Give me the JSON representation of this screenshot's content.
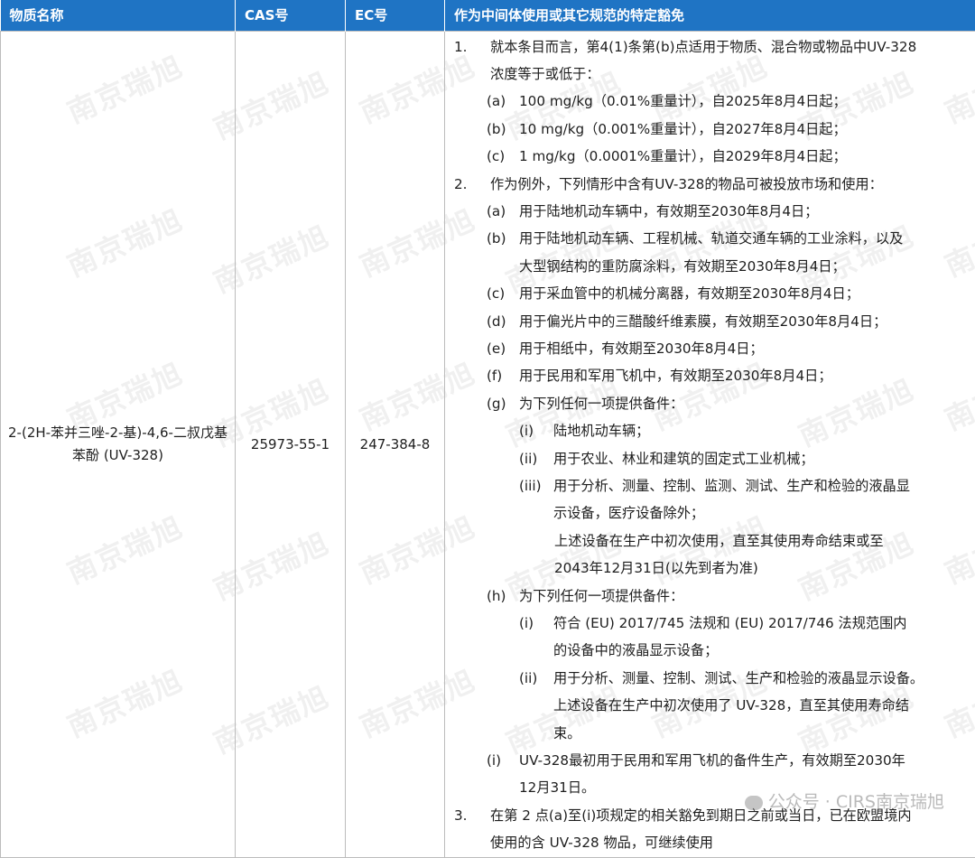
{
  "headers": [
    "物质名称",
    "CAS号",
    "EC号",
    "作为中间体使用或其它规范的特定豁免"
  ],
  "substance": {
    "name": "2-(2H-苯并三唑-2-基)-4,6-二叔戊基苯酚 (UV-328)",
    "cas": "25973-55-1",
    "ec": "247-384-8"
  },
  "exemptions": [
    {
      "level": 1,
      "marker": "1.",
      "lines": [
        "就本条目而言，第4(1)条第(b)点适用于物质、混合物或物品中UV-328",
        "浓度等于或低于："
      ]
    },
    {
      "level": 2,
      "marker": "(a)",
      "lines": [
        "100 mg/kg（0.01%重量计），自2025年8月4日起；"
      ]
    },
    {
      "level": 2,
      "marker": "(b)",
      "lines": [
        "10 mg/kg（0.001%重量计），自2027年8月4日起；"
      ]
    },
    {
      "level": 2,
      "marker": "(c)",
      "lines": [
        "1 mg/kg（0.0001%重量计），自2029年8月4日起；"
      ]
    },
    {
      "level": 1,
      "marker": "2.",
      "lines": [
        "作为例外，下列情形中含有UV-328的物品可被投放市场和使用："
      ]
    },
    {
      "level": 2,
      "marker": "(a)",
      "lines": [
        "用于陆地机动车辆中，有效期至2030年8月4日；"
      ]
    },
    {
      "level": 2,
      "marker": "(b)",
      "lines": [
        "用于陆地机动车辆、工程机械、轨道交通车辆的工业涂料，以及",
        "大型钢结构的重防腐涂料，有效期至2030年8月4日；"
      ]
    },
    {
      "level": 2,
      "marker": "(c)",
      "lines": [
        "用于采血管中的机械分离器，有效期至2030年8月4日；"
      ]
    },
    {
      "level": 2,
      "marker": "(d)",
      "lines": [
        "用于偏光片中的三醋酸纤维素膜，有效期至2030年8月4日；"
      ]
    },
    {
      "level": 2,
      "marker": "(e)",
      "lines": [
        "用于相纸中，有效期至2030年8月4日；"
      ]
    },
    {
      "level": 2,
      "marker": "(f)",
      "lines": [
        "用于民用和军用飞机中，有效期至2030年8月4日；"
      ]
    },
    {
      "level": 2,
      "marker": "(g)",
      "lines": [
        "为下列任何一项提供备件："
      ]
    },
    {
      "level": 3,
      "marker": "(i)",
      "lines": [
        "陆地机动车辆；"
      ]
    },
    {
      "level": 3,
      "marker": "(ii)",
      "lines": [
        "用于农业、林业和建筑的固定式工业机械；"
      ]
    },
    {
      "level": 3,
      "marker": "(iii)",
      "lines": [
        "用于分析、测量、控制、监测、测试、生产和检验的液晶显",
        "示设备，医疗设备除外；"
      ]
    },
    {
      "level": 0,
      "marker": "",
      "lines": [
        "上述设备在生产中初次使用，直至其使用寿命结束或至",
        "2043年12月31日(以先到者为准)"
      ]
    },
    {
      "level": 2,
      "marker": "(h)",
      "lines": [
        "为下列任何一项提供备件："
      ]
    },
    {
      "level": 3,
      "marker": "(i)",
      "lines": [
        "符合 (EU) 2017/745 法规和 (EU) 2017/746 法规范围内",
        "的设备中的液晶显示设备；"
      ]
    },
    {
      "level": 3,
      "marker": "(ii)",
      "lines": [
        "用于分析、测量、控制、测试、生产和检验的液晶显示设备。",
        "上述设备在生产中初次使用了 UV-328，直至其使用寿命结",
        "束。"
      ]
    },
    {
      "level": 2,
      "marker": "(i)",
      "lines": [
        "UV-328最初用于民用和军用飞机的备件生产，有效期至2030年",
        "12月31日。"
      ]
    },
    {
      "level": 1,
      "marker": "3.",
      "lines": [
        "在第 2 点(a)至(i)项规定的相关豁免到期日之前或当日，已在欧盟境内",
        "使用的含 UV-328 物品，可继续使用"
      ]
    }
  ],
  "watermark": "南京瑞旭",
  "footer_watermark": "公众号 · CIRS南京瑞旭",
  "colors": {
    "header_bg": "#1f74c4",
    "header_text": "#ffffff",
    "border": "#bcbcbc"
  }
}
